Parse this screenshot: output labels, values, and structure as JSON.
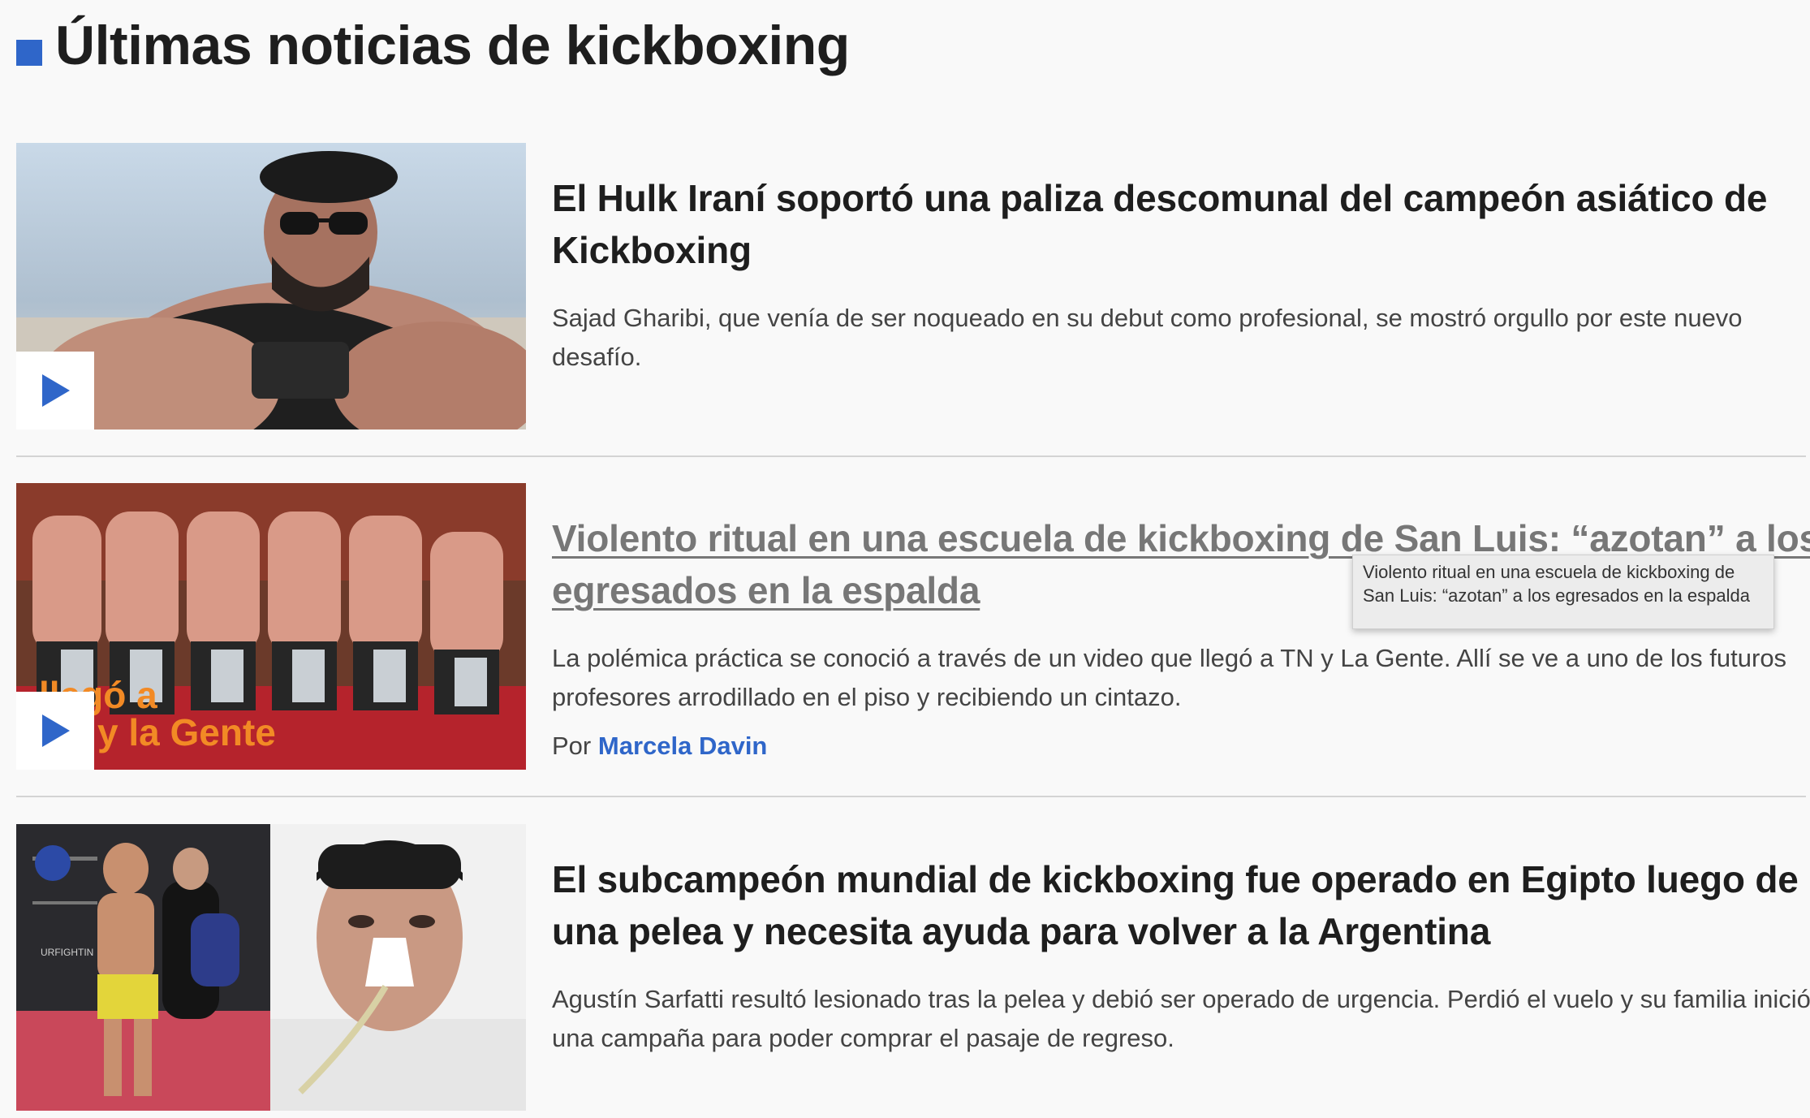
{
  "section": {
    "title": "Últimas noticias de kickboxing",
    "accent_color": "#2f66c9"
  },
  "articles": [
    {
      "headline": "El Hulk Iraní soportó una paliza descomunal del campeón asiático de Kickboxing",
      "summary": "Sajad Gharibi, que venía de ser noqueado en su debut como profesional, se mostró orgullo por este nuevo desafío.",
      "has_video": true
    },
    {
      "headline": "Violento ritual en una escuela de kickboxing de San Luis: “azotan” a los egresados en la espalda",
      "summary": "La polémica práctica se conoció a través de un video que llegó a TN y La Gente. Allí se ve a uno de los futuros profesores arrodillado en el piso y recibiendo un cintazo.",
      "byline_prefix": "Por",
      "author": "Marcela Davin",
      "has_video": true,
      "image_overlay_text": [
        "llegó a",
        "y la Gente"
      ],
      "tooltip": "Violento ritual en una escuela de kickboxing de San Luis: “azotan” a los egresados en la espalda"
    },
    {
      "headline": "El subcampeón mundial de kickboxing fue operado en Egipto luego de una pelea y necesita ayuda para volver a la Argentina",
      "summary": "Agustín Sarfatti resultó lesionado tras la pelea y debió ser operado de urgencia. Perdió el vuelo y su familia inició una campaña para poder comprar el pasaje de regreso.",
      "has_video": false,
      "image_text": "URFIGHTIN"
    }
  ]
}
